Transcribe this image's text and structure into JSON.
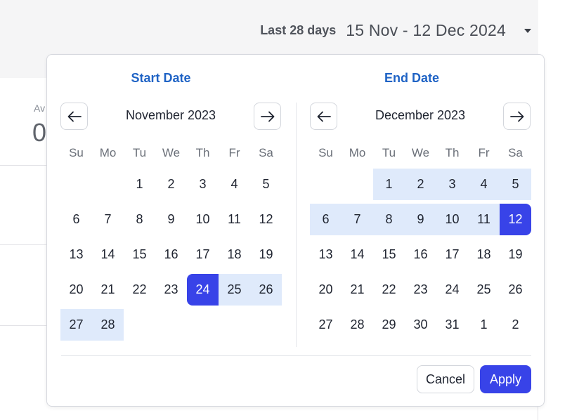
{
  "range_selector": {
    "label": "Last 28 days",
    "value": "15 Nov - 12 Dec 2024"
  },
  "background": {
    "metric_label": "Av",
    "metric_value": "0"
  },
  "picker": {
    "start_title": "Start Date",
    "end_title": "End Date",
    "weekdays": [
      "Su",
      "Mo",
      "Tu",
      "We",
      "Th",
      "Fr",
      "Sa"
    ],
    "left_month": {
      "title": "November 2023",
      "weeks": [
        [
          {
            "d": ""
          },
          {
            "d": ""
          },
          {
            "d": "1"
          },
          {
            "d": "2"
          },
          {
            "d": "3"
          },
          {
            "d": "4"
          },
          {
            "d": "5"
          }
        ],
        [
          {
            "d": "6"
          },
          {
            "d": "7"
          },
          {
            "d": "8"
          },
          {
            "d": "9"
          },
          {
            "d": "10"
          },
          {
            "d": "11"
          },
          {
            "d": "12"
          }
        ],
        [
          {
            "d": "13"
          },
          {
            "d": "14"
          },
          {
            "d": "15"
          },
          {
            "d": "16"
          },
          {
            "d": "17"
          },
          {
            "d": "18"
          },
          {
            "d": "19"
          }
        ],
        [
          {
            "d": "20"
          },
          {
            "d": "21"
          },
          {
            "d": "22"
          },
          {
            "d": "23"
          },
          {
            "d": "24",
            "s": "start"
          },
          {
            "d": "25",
            "s": "range"
          },
          {
            "d": "26",
            "s": "range"
          }
        ],
        [
          {
            "d": "27",
            "s": "range"
          },
          {
            "d": "28",
            "s": "range"
          },
          {
            "d": ""
          },
          {
            "d": ""
          },
          {
            "d": ""
          },
          {
            "d": ""
          },
          {
            "d": ""
          }
        ]
      ]
    },
    "right_month": {
      "title": "December 2023",
      "weeks": [
        [
          {
            "d": ""
          },
          {
            "d": ""
          },
          {
            "d": "1",
            "s": "range"
          },
          {
            "d": "2",
            "s": "range"
          },
          {
            "d": "3",
            "s": "range"
          },
          {
            "d": "4",
            "s": "range"
          },
          {
            "d": "5",
            "s": "range"
          }
        ],
        [
          {
            "d": "6",
            "s": "range"
          },
          {
            "d": "7",
            "s": "range"
          },
          {
            "d": "8",
            "s": "range"
          },
          {
            "d": "9",
            "s": "range"
          },
          {
            "d": "10",
            "s": "range"
          },
          {
            "d": "11",
            "s": "range"
          },
          {
            "d": "12",
            "s": "end"
          }
        ],
        [
          {
            "d": "13"
          },
          {
            "d": "14"
          },
          {
            "d": "15"
          },
          {
            "d": "16"
          },
          {
            "d": "17"
          },
          {
            "d": "18"
          },
          {
            "d": "19"
          }
        ],
        [
          {
            "d": "20"
          },
          {
            "d": "21"
          },
          {
            "d": "22"
          },
          {
            "d": "23"
          },
          {
            "d": "24"
          },
          {
            "d": "25"
          },
          {
            "d": "26"
          }
        ],
        [
          {
            "d": "27"
          },
          {
            "d": "28"
          },
          {
            "d": "29"
          },
          {
            "d": "30"
          },
          {
            "d": "31"
          },
          {
            "d": "1"
          },
          {
            "d": "2"
          }
        ]
      ]
    },
    "cancel_label": "Cancel",
    "apply_label": "Apply"
  },
  "icons": {
    "prev": "arrow-left-icon",
    "next": "arrow-right-icon",
    "dropdown": "caret-down-icon"
  },
  "colors": {
    "accent": "#3843e8",
    "range": "#dfeafb",
    "title": "#1f63c5"
  }
}
